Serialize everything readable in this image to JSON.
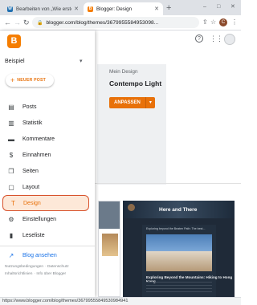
{
  "browser": {
    "tabs": [
      {
        "title": "Bearbeiten von „Wie erstelle ic",
        "favicon": "wordpress-icon",
        "active": false
      },
      {
        "title": "Blogger: Design",
        "favicon": "blogger-icon",
        "active": true
      }
    ],
    "new_tab": "+",
    "window_controls": {
      "minimize": "–",
      "maximize": "□",
      "close": "✕"
    },
    "url": "blogger.com/blog/themes/3679955584953098...",
    "profile_initial": "C",
    "status_url": "https://www.blogger.com/blog/themes/36799555849530984941"
  },
  "header": {
    "help": "?",
    "apps": "⋮⋮⋮"
  },
  "sidebar": {
    "logo_letter": "B",
    "blog_name": "Beispiel",
    "new_post_label": "NEUER POST",
    "items": [
      {
        "label": "Posts",
        "icon": "posts-icon",
        "glyph": "▤"
      },
      {
        "label": "Statistik",
        "icon": "stats-icon",
        "glyph": "▥"
      },
      {
        "label": "Kommentare",
        "icon": "comments-icon",
        "glyph": "▬"
      },
      {
        "label": "Einnahmen",
        "icon": "dollar-icon",
        "glyph": "$"
      },
      {
        "label": "Seiten",
        "icon": "pages-icon",
        "glyph": "❐"
      },
      {
        "label": "Layout",
        "icon": "layout-icon",
        "glyph": "▢"
      },
      {
        "label": "Design",
        "icon": "paint-roller-icon",
        "glyph": "T",
        "active": true
      },
      {
        "label": "Einstellungen",
        "icon": "gear-icon",
        "glyph": "⚙"
      },
      {
        "label": "Leseliste",
        "icon": "bookmark-icon",
        "glyph": "▮"
      }
    ],
    "view_blog_label": "Blog ansehen",
    "footer_links": [
      "Nutzungsbedingungen",
      "Datenschutz",
      "Inhaltsrichtlinien",
      "Info über Blogger"
    ]
  },
  "main": {
    "design_label": "Mein Design",
    "design_name": "Contempo Light",
    "customize_label": "ANPASSEN",
    "thumb_title": "Here and There",
    "thumb_card_title": "Exploring beyond the Beaten Path: The best...",
    "thumb_post_title": "Exploring Beyond the Mountains: Hiking to Hong Kong"
  },
  "colors": {
    "accent": "#e8710a",
    "active_bg": "#fde8d8",
    "active_border": "#d8522c",
    "link": "#1a73e8"
  }
}
